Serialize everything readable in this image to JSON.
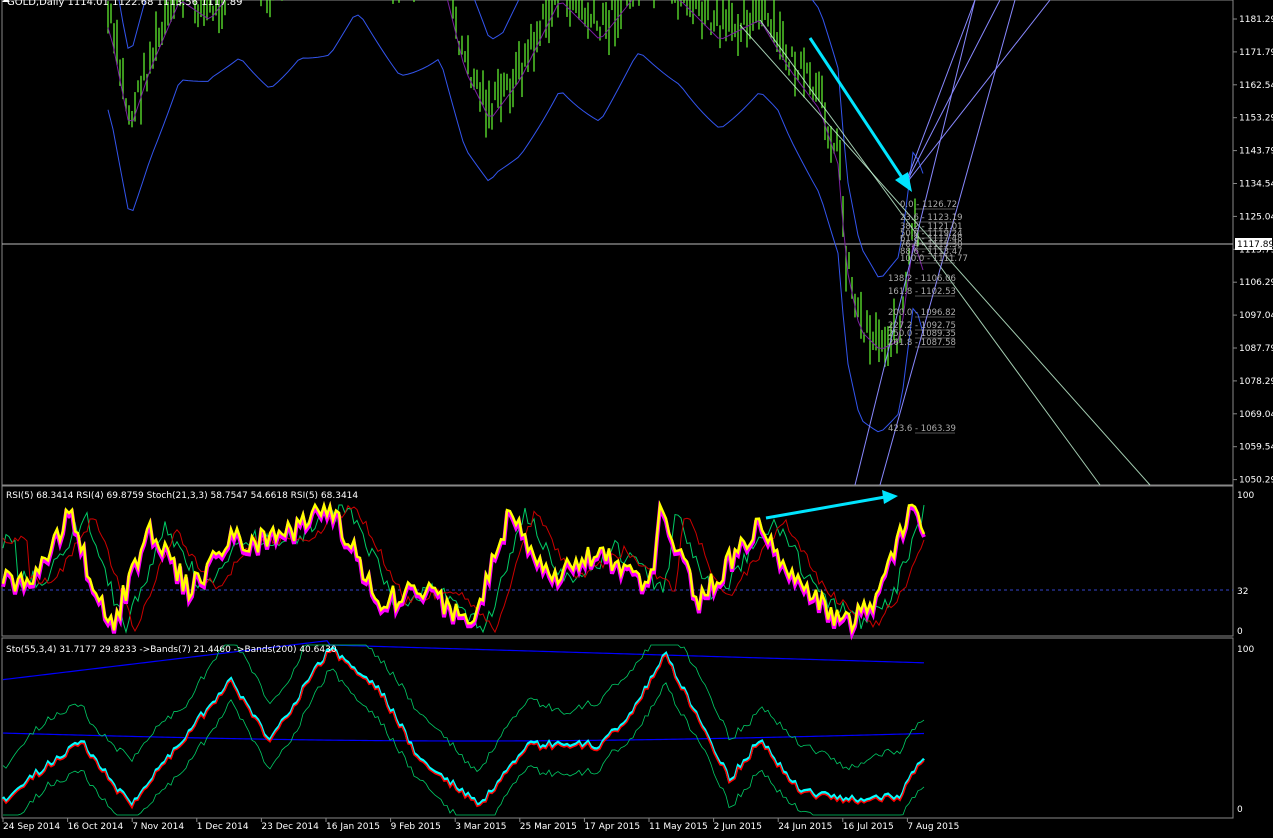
{
  "window": {
    "symbol_label": "GOLD,Daily  1114.01 1122.68 1113.56 1117.89"
  },
  "colors": {
    "background": "#000000",
    "candle": "#66ff33",
    "bands": "#3355ee",
    "sma": "#7a1fa0",
    "rsi5": "#ffff00",
    "rsi4": "#ff00ff",
    "stoch_k": "#00cc66",
    "stoch_d": "#cc0000",
    "arrow": "#00e5ff",
    "fib": "#aaaaaa",
    "axis_text": "#ffffff",
    "sto_main": "#00ffff",
    "sto_signal": "#ff0000",
    "band_line": "#0000ff"
  },
  "main_panel": {
    "price_axis": {
      "ticks": [
        "1181.29",
        "1171.79",
        "1162.54",
        "1153.29",
        "1143.79",
        "1134.54",
        "1125.04",
        "1115.79",
        "1106.29",
        "1097.04",
        "1087.79",
        "1078.29",
        "1069.04",
        "1059.54",
        "1050.29"
      ],
      "current_price": "1117.89"
    },
    "fib_levels": [
      {
        "label": "0.0 - 1126.72"
      },
      {
        "label": "23.6 - 1123.19"
      },
      {
        "label": "38.2 - 1121.01"
      },
      {
        "label": "50.0 - 1119.24"
      },
      {
        "label": "61.8 - 1117.48"
      },
      {
        "label": "76.4 - 1115.30"
      },
      {
        "label": "88.6 - 1113.47"
      },
      {
        "label": "100.0 - 1111.77"
      },
      {
        "label": "138.2 - 1106.06"
      },
      {
        "label": "161.8 - 1102.53"
      },
      {
        "label": "200.0 - 1096.82"
      },
      {
        "label": "227.2 - 1092.75"
      },
      {
        "label": "250.0 - 1089.35"
      },
      {
        "label": "261.8 - 1087.58"
      },
      {
        "label": "423.6 - 1063.39"
      }
    ]
  },
  "rsi_panel": {
    "label": "RSI(5) 68.3414  RSI(4) 69.8759  Stoch(21,3,3) 58.7547 54.6618  RSI(5) 68.3414",
    "scale": {
      "top": "100",
      "mid": "32",
      "bottom": "0"
    }
  },
  "sto_panel": {
    "label": "Sto(55,3,4) 31.7177 29.8233  ->Bands(7) 21.4460  ->Bands(200) 40.6430",
    "scale": {
      "top": "100",
      "bottom": "0"
    }
  },
  "time_axis": {
    "labels": [
      "24 Sep 2014",
      "16 Oct 2014",
      "7 Nov 2014",
      "1 Dec 2014",
      "23 Dec 2014",
      "16 Jan 2015",
      "9 Feb 2015",
      "3 Mar 2015",
      "25 Mar 2015",
      "17 Apr 2015",
      "11 May 2015",
      "2 Jun 2015",
      "24 Jun 2015",
      "16 Jul 2015",
      "7 Aug 2015"
    ]
  }
}
